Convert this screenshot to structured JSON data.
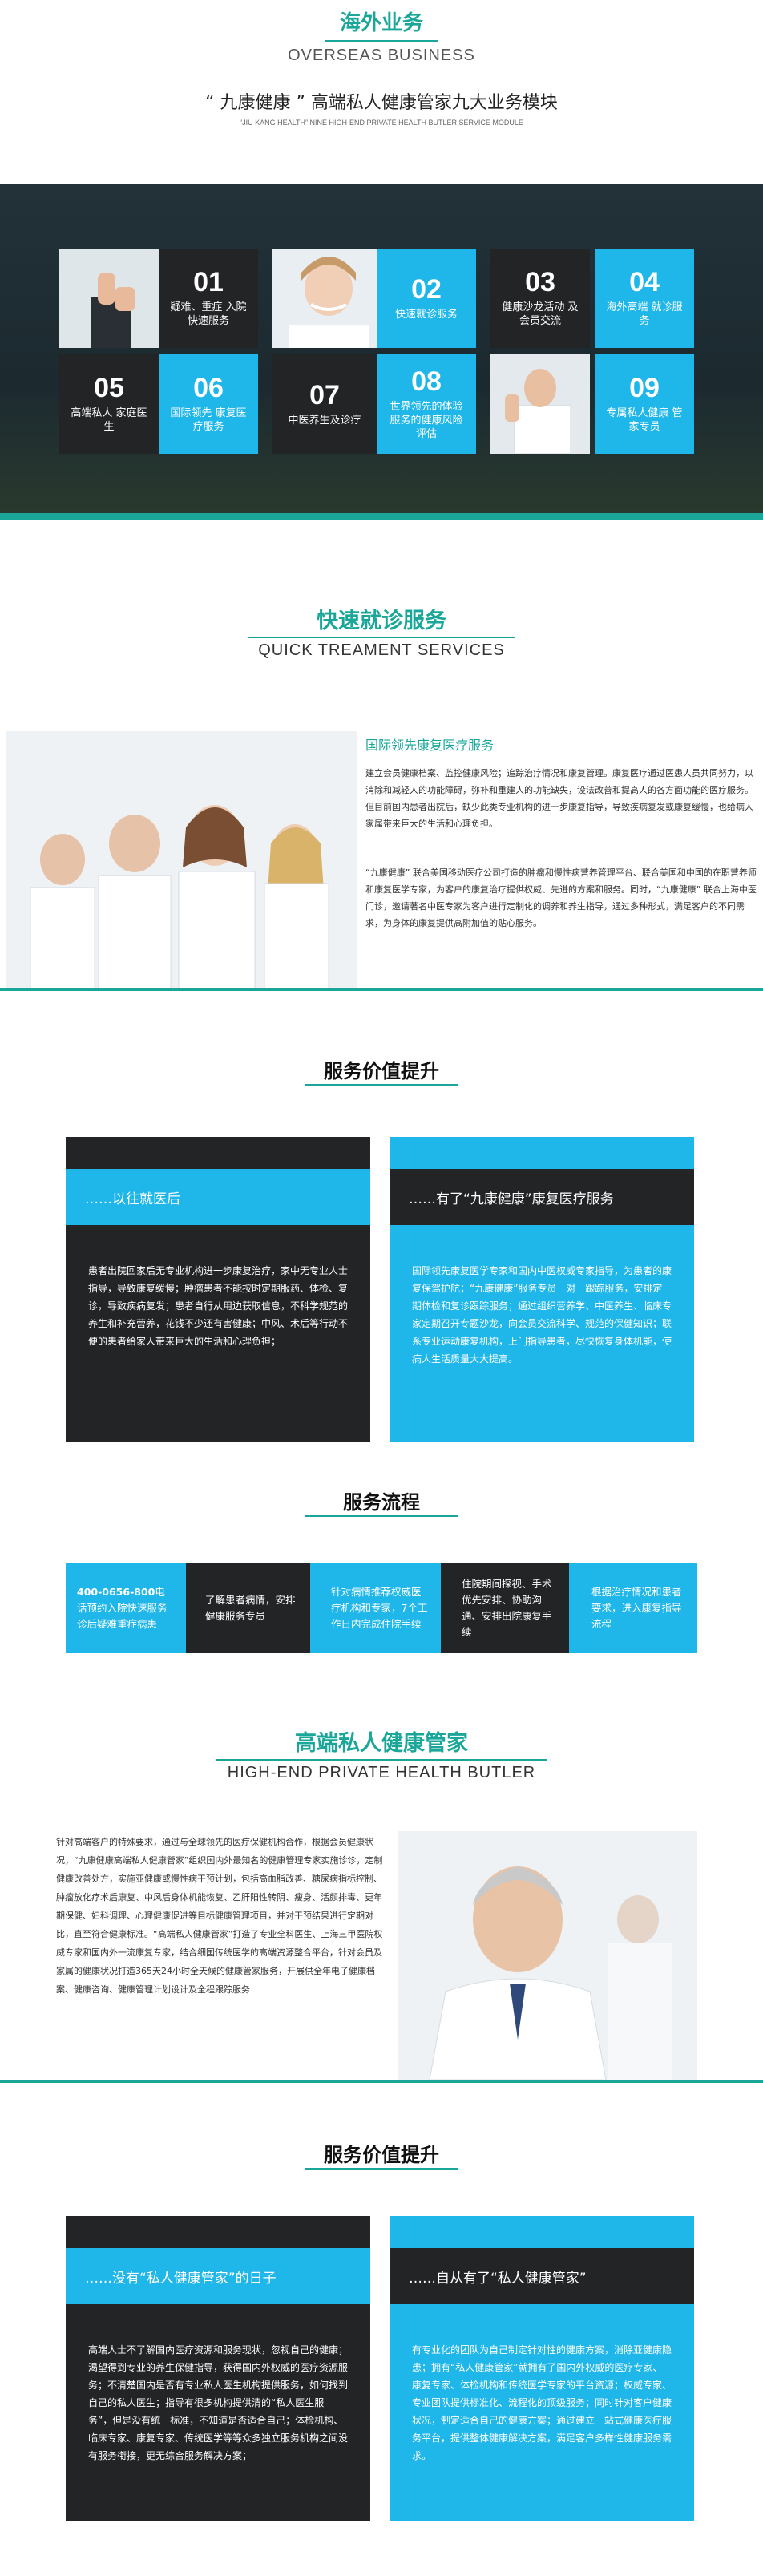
{
  "header": {
    "cn_title": "海外业务",
    "en_title": "OVERSEAS BUSINESS",
    "module_title": "“ 九康健康 ” 高端私人健康管家九大业务模块",
    "module_sub": "“JIU KANG HEALTH” NINE HIGH-END PRIVATE HEALTH BUTLER SERVICE MODULE"
  },
  "modules": [
    {
      "num": "01",
      "label": "疑难、重症 入院快速服务"
    },
    {
      "num": "02",
      "label": "快速就诊服务"
    },
    {
      "num": "03",
      "label": "健康沙龙活动 及会员交流"
    },
    {
      "num": "04",
      "label": "海外高端 就诊服务"
    },
    {
      "num": "05",
      "label": "高端私人 家庭医生"
    },
    {
      "num": "06",
      "label": "国际领先 康复医疗服务"
    },
    {
      "num": "07",
      "label": "中医养生及诊疗"
    },
    {
      "num": "08",
      "label": "世界领先的体验 服务的健康风险 评估"
    },
    {
      "num": "09",
      "label": "专属私人健康 管家专员"
    }
  ],
  "quick": {
    "cn_title": "快速就诊服务",
    "en_title": "QUICK TREAMENT SERVICES",
    "sub_title": "国际领先康复医疗服务",
    "p1": "建立会员健康档案、监控健康风险；追踪治疗情况和康复管理。康复医疗通过医患人员共同努力，以消除和减轻人的功能障碍，弥补和重建人的功能缺失，设法改善和提高人的各方面功能的医疗服务。但目前国内患者出院后，缺少此类专业机构的进一步康复指导，导致疾病复发或康复缓慢，也给病人家属带来巨大的生活和心理负担。",
    "p2": "“九康健康” 联合美国移动医疗公司打造的肿瘤和慢性病营养管理平台、联合美国和中国的在职营养师和康复医学专家，为客户的康复治疗提供权威、先进的方案和服务。同时，“九康健康” 联合上海中医门诊，邀请著名中医专家为客户进行定制化的调养和养生指导，通过多种形式，满足客户的不同需求，为身体的康复提供高附加值的贴心服务。"
  },
  "value1": {
    "title": "服务价值提升",
    "left_head": "……以往就医后",
    "left_body": "患者出院回家后无专业机构进一步康复治疗，家中无专业人士指导，导致康复缓慢；肿瘤患者不能按时定期服药、体检、复诊，导致疾病复发；患者自行从用边获取信息，不科学规范的养生和补充营养，花钱不少还有害健康；中风、术后等行动不便的患者给家人带来巨大的生活和心理负担；",
    "right_head": "……有了“九康健康”康复医疗服务",
    "right_body": "国际领先康复医学专家和国内中医权威专家指导，为患者的康复保驾护航；“九康健康”服务专员一对一跟踪服务，安排定期体检和复诊跟踪服务；通过组织营养学、中医养生、临床专家定期召开专题沙龙，向会员交流科学、规范的保健知识；联系专业运动康复机构，上门指导患者，尽快恢复身体机能，使病人生活质量大大提高。"
  },
  "flow": {
    "title": "服务流程",
    "steps": [
      {
        "strong": "400-0656-800",
        "text": "电话预约入院快速服务诊后疑难重症病患"
      },
      {
        "strong": "",
        "text": "了解患者病情，安排健康服务专员"
      },
      {
        "strong": "",
        "text": "针对病情推荐权威医疗机构和专家，7个工作日内完成住院手续"
      },
      {
        "strong": "",
        "text": "住院期间探视、手术优先安排、协助沟通、安排出院康复手续"
      },
      {
        "strong": "",
        "text": "根据治疗情况和患者要求，进入康复指导流程"
      }
    ]
  },
  "butler": {
    "cn_title": "高端私人健康管家",
    "en_title": "HIGH-END PRIVATE HEALTH BUTLER",
    "p1": "针对高端客户的特殊要求，通过与全球领先的医疗保健机构合作，根据会员健康状况，“九康健康高端私人健康管家”组织国内外最知名的健康管理专家实施诊诊，定制健康改善处方，实施亚健康或慢性病干预计划，包括高血脂改善、糖尿病指标控制、肿瘤放化疗术后康复、中风后身体机能恢复、乙肝阳性转阴、瘦身、活颜排毒、更年期保健、妇科调理、心理健康促进等目标健康管理项目，并对干预结果进行定期对比，直至符合健康标准。“高端私人健康管家”打造了专业全科医生、上海三甲医院权威专家和国内外一流康复专家，结合细国传统医学的高端资源整合平台，针对会员及家属的健康状况打造365天24小时全天候的健康管家服务，开展供全年电子健康档案、健康咨询、健康管理计划设计及全程跟踪服务"
  },
  "value2": {
    "title": "服务价值提升",
    "left_head": "……没有“私人健康管家”的日子",
    "left_body": "高端人士不了解国内医疗资源和服务现状，忽视自己的健康；渴望得到专业的养生保健指导，获得国内外权威的医疗资源服务；不清楚国内是否有专业私人医生机构提供服务，如何找到自己的私人医生；指导有很多机构提供清的“私人医生服务”，但是没有统一标准，不知道是否适合自己；体检机构、临床专家、康复专家、传统医学等等众多独立服务机构之间没有服务衔接，更无综合服务解决方案；",
    "right_head": "……自从有了“私人健康管家”",
    "right_body": "有专业化的团队为自己制定针对性的健康方案，消除亚健康隐患；拥有“私人健康管家”就拥有了国内外权威的医疗专家、康复专家、体检机构和传统医学专家的平台资源；权威专家、专业团队提供标准化、流程化的顶级服务；同时针对客户健康状况，制定适合自己的健康方案；通过建立一站式健康医疗服务平台，提供整体健康解决方案，满足客户多样性健康服务需求。"
  },
  "colors": {
    "teal": "#1aa79a",
    "blue": "#1fb6ea",
    "dark": "#222426"
  }
}
